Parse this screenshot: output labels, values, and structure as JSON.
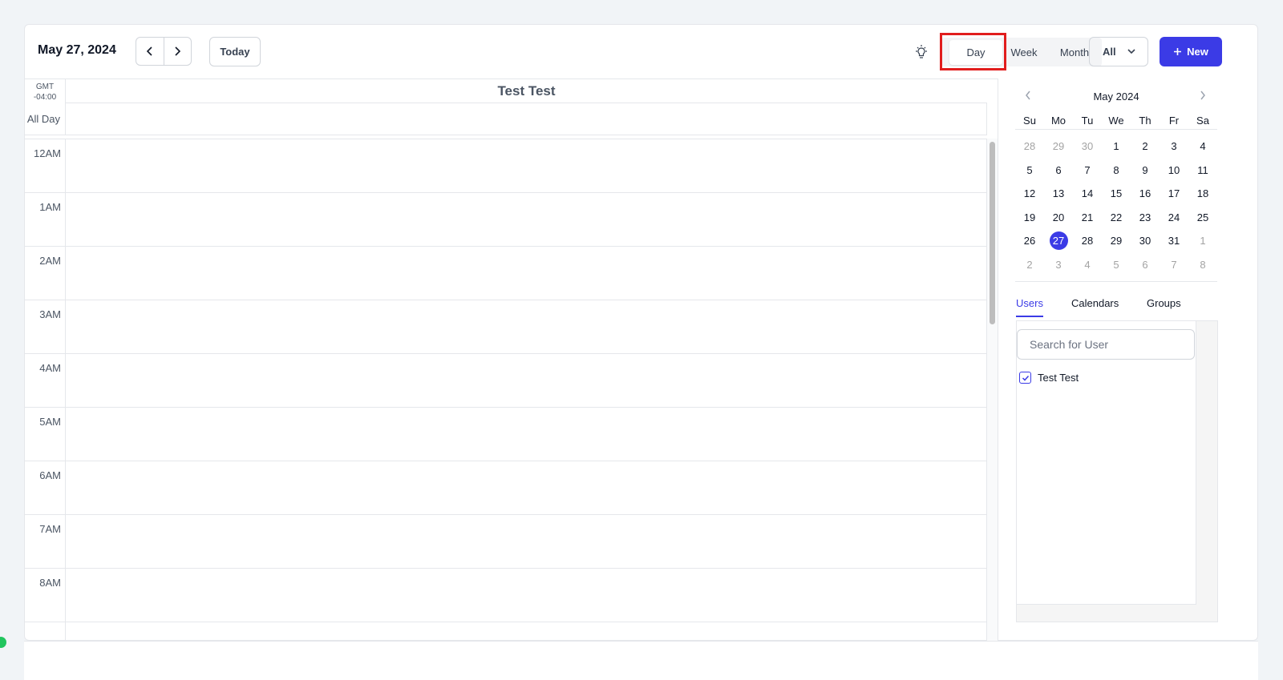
{
  "header": {
    "date_title": "May 27, 2024",
    "today_label": "Today",
    "views": {
      "day": "Day",
      "week": "Week",
      "month": "Month"
    },
    "filter_value": "All",
    "new_label": "New"
  },
  "grid": {
    "timezone_line1": "GMT",
    "timezone_line2": "-04:00",
    "column_header": "Test Test",
    "all_day_label": "All Day",
    "hours": [
      "12AM",
      "1AM",
      "2AM",
      "3AM",
      "4AM",
      "5AM",
      "6AM",
      "7AM",
      "8AM",
      ""
    ]
  },
  "mini_calendar": {
    "title": "May 2024",
    "weekdays": [
      "Su",
      "Mo",
      "Tu",
      "We",
      "Th",
      "Fr",
      "Sa"
    ],
    "weeks": [
      [
        "28",
        "29",
        "30",
        "1",
        "2",
        "3",
        "4"
      ],
      [
        "5",
        "6",
        "7",
        "8",
        "9",
        "10",
        "11"
      ],
      [
        "12",
        "13",
        "14",
        "15",
        "16",
        "17",
        "18"
      ],
      [
        "19",
        "20",
        "21",
        "22",
        "23",
        "24",
        "25"
      ],
      [
        "26",
        "27",
        "28",
        "29",
        "30",
        "31",
        "1"
      ],
      [
        "2",
        "3",
        "4",
        "5",
        "6",
        "7",
        "8"
      ]
    ],
    "selected": "27"
  },
  "sidebar": {
    "tabs": {
      "users": "Users",
      "calendars": "Calendars",
      "groups": "Groups"
    },
    "search_placeholder": "Search for User",
    "users": [
      {
        "name": "Test Test",
        "checked": true
      }
    ]
  },
  "colors": {
    "accent": "#3b3be6",
    "highlight": "#e11d1d"
  }
}
